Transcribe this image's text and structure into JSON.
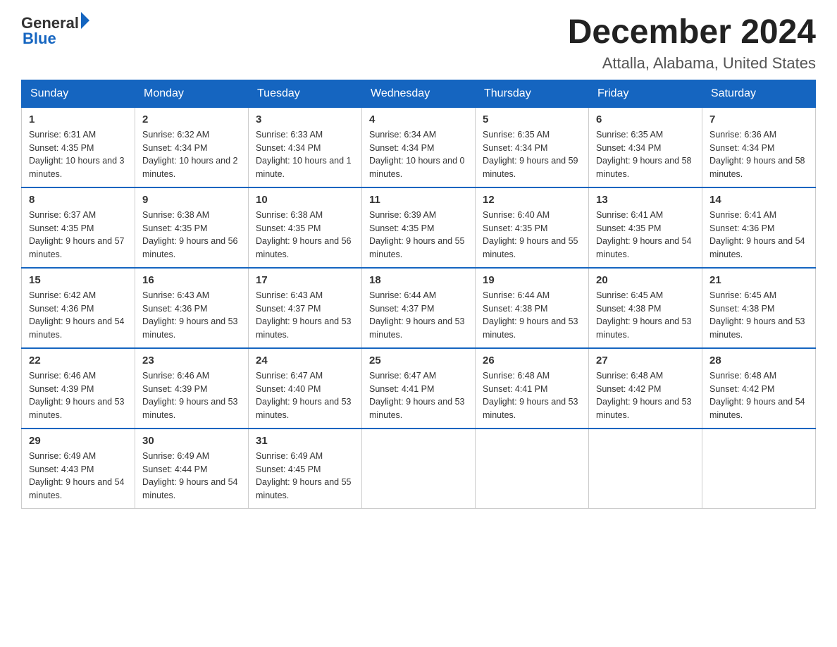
{
  "header": {
    "logo_general": "General",
    "logo_blue": "Blue",
    "month": "December 2024",
    "location": "Attalla, Alabama, United States"
  },
  "weekdays": [
    "Sunday",
    "Monday",
    "Tuesday",
    "Wednesday",
    "Thursday",
    "Friday",
    "Saturday"
  ],
  "weeks": [
    [
      {
        "day": "1",
        "sunrise": "6:31 AM",
        "sunset": "4:35 PM",
        "daylight": "10 hours and 3 minutes."
      },
      {
        "day": "2",
        "sunrise": "6:32 AM",
        "sunset": "4:34 PM",
        "daylight": "10 hours and 2 minutes."
      },
      {
        "day": "3",
        "sunrise": "6:33 AM",
        "sunset": "4:34 PM",
        "daylight": "10 hours and 1 minute."
      },
      {
        "day": "4",
        "sunrise": "6:34 AM",
        "sunset": "4:34 PM",
        "daylight": "10 hours and 0 minutes."
      },
      {
        "day": "5",
        "sunrise": "6:35 AM",
        "sunset": "4:34 PM",
        "daylight": "9 hours and 59 minutes."
      },
      {
        "day": "6",
        "sunrise": "6:35 AM",
        "sunset": "4:34 PM",
        "daylight": "9 hours and 58 minutes."
      },
      {
        "day": "7",
        "sunrise": "6:36 AM",
        "sunset": "4:34 PM",
        "daylight": "9 hours and 58 minutes."
      }
    ],
    [
      {
        "day": "8",
        "sunrise": "6:37 AM",
        "sunset": "4:35 PM",
        "daylight": "9 hours and 57 minutes."
      },
      {
        "day": "9",
        "sunrise": "6:38 AM",
        "sunset": "4:35 PM",
        "daylight": "9 hours and 56 minutes."
      },
      {
        "day": "10",
        "sunrise": "6:38 AM",
        "sunset": "4:35 PM",
        "daylight": "9 hours and 56 minutes."
      },
      {
        "day": "11",
        "sunrise": "6:39 AM",
        "sunset": "4:35 PM",
        "daylight": "9 hours and 55 minutes."
      },
      {
        "day": "12",
        "sunrise": "6:40 AM",
        "sunset": "4:35 PM",
        "daylight": "9 hours and 55 minutes."
      },
      {
        "day": "13",
        "sunrise": "6:41 AM",
        "sunset": "4:35 PM",
        "daylight": "9 hours and 54 minutes."
      },
      {
        "day": "14",
        "sunrise": "6:41 AM",
        "sunset": "4:36 PM",
        "daylight": "9 hours and 54 minutes."
      }
    ],
    [
      {
        "day": "15",
        "sunrise": "6:42 AM",
        "sunset": "4:36 PM",
        "daylight": "9 hours and 54 minutes."
      },
      {
        "day": "16",
        "sunrise": "6:43 AM",
        "sunset": "4:36 PM",
        "daylight": "9 hours and 53 minutes."
      },
      {
        "day": "17",
        "sunrise": "6:43 AM",
        "sunset": "4:37 PM",
        "daylight": "9 hours and 53 minutes."
      },
      {
        "day": "18",
        "sunrise": "6:44 AM",
        "sunset": "4:37 PM",
        "daylight": "9 hours and 53 minutes."
      },
      {
        "day": "19",
        "sunrise": "6:44 AM",
        "sunset": "4:38 PM",
        "daylight": "9 hours and 53 minutes."
      },
      {
        "day": "20",
        "sunrise": "6:45 AM",
        "sunset": "4:38 PM",
        "daylight": "9 hours and 53 minutes."
      },
      {
        "day": "21",
        "sunrise": "6:45 AM",
        "sunset": "4:38 PM",
        "daylight": "9 hours and 53 minutes."
      }
    ],
    [
      {
        "day": "22",
        "sunrise": "6:46 AM",
        "sunset": "4:39 PM",
        "daylight": "9 hours and 53 minutes."
      },
      {
        "day": "23",
        "sunrise": "6:46 AM",
        "sunset": "4:39 PM",
        "daylight": "9 hours and 53 minutes."
      },
      {
        "day": "24",
        "sunrise": "6:47 AM",
        "sunset": "4:40 PM",
        "daylight": "9 hours and 53 minutes."
      },
      {
        "day": "25",
        "sunrise": "6:47 AM",
        "sunset": "4:41 PM",
        "daylight": "9 hours and 53 minutes."
      },
      {
        "day": "26",
        "sunrise": "6:48 AM",
        "sunset": "4:41 PM",
        "daylight": "9 hours and 53 minutes."
      },
      {
        "day": "27",
        "sunrise": "6:48 AM",
        "sunset": "4:42 PM",
        "daylight": "9 hours and 53 minutes."
      },
      {
        "day": "28",
        "sunrise": "6:48 AM",
        "sunset": "4:42 PM",
        "daylight": "9 hours and 54 minutes."
      }
    ],
    [
      {
        "day": "29",
        "sunrise": "6:49 AM",
        "sunset": "4:43 PM",
        "daylight": "9 hours and 54 minutes."
      },
      {
        "day": "30",
        "sunrise": "6:49 AM",
        "sunset": "4:44 PM",
        "daylight": "9 hours and 54 minutes."
      },
      {
        "day": "31",
        "sunrise": "6:49 AM",
        "sunset": "4:45 PM",
        "daylight": "9 hours and 55 minutes."
      },
      null,
      null,
      null,
      null
    ]
  ],
  "labels": {
    "sunrise": "Sunrise:",
    "sunset": "Sunset:",
    "daylight": "Daylight:"
  }
}
